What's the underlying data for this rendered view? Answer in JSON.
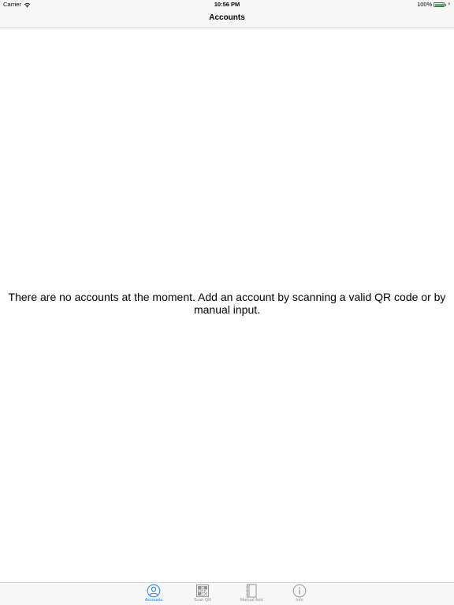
{
  "status_bar": {
    "carrier": "Carrier",
    "time": "10:56 PM",
    "battery": "100%",
    "battery_level": 1.0
  },
  "nav": {
    "title": "Accounts"
  },
  "main": {
    "empty_message": "There are no accounts at the moment. Add an account by scanning a valid QR code or by manual input."
  },
  "tab_bar": {
    "tabs": [
      {
        "label": "Accounts",
        "icon": "person-circle-icon",
        "active": true
      },
      {
        "label": "Scan QR",
        "icon": "qr-code-icon",
        "active": false
      },
      {
        "label": "Manual Add",
        "icon": "notebook-icon",
        "active": false
      },
      {
        "label": "Info",
        "icon": "info-icon",
        "active": false
      }
    ]
  },
  "colors": {
    "accent": "#157efb",
    "inactive": "#929292",
    "battery": "#35c759",
    "bar_background": "#f7f7f7"
  }
}
